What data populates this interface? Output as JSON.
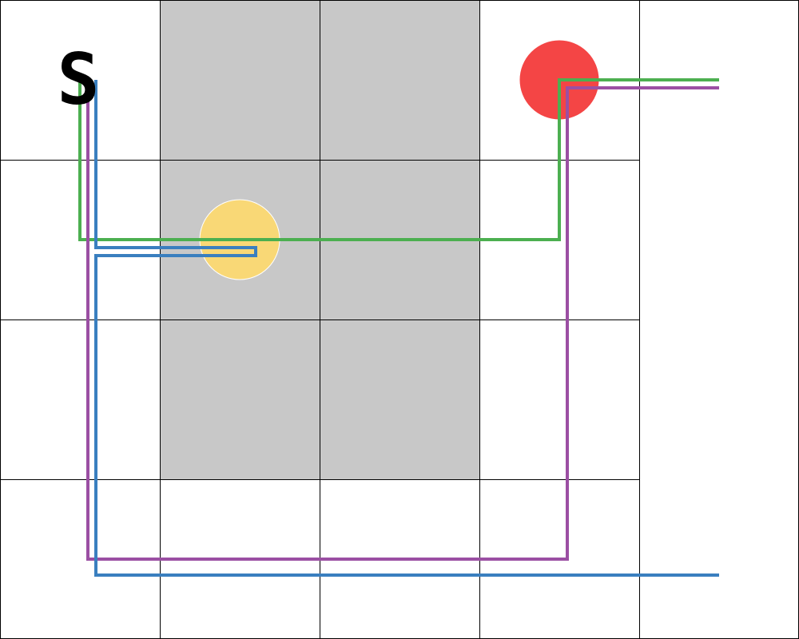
{
  "grid": {
    "cols": 5,
    "rows": 4,
    "blocked_cells": [
      [
        1,
        0
      ],
      [
        2,
        0
      ],
      [
        1,
        1
      ],
      [
        2,
        1
      ],
      [
        1,
        2
      ],
      [
        2,
        2
      ]
    ],
    "colors": {
      "background": "#ffffff",
      "blocked": "#c8c8c8",
      "line": "#000000"
    }
  },
  "start": {
    "label": "S",
    "cell": [
      0,
      0
    ]
  },
  "tokens": [
    {
      "name": "red-goal-token",
      "cell": [
        3,
        0
      ],
      "color": "#f44545"
    },
    {
      "name": "yellow-token",
      "cell": [
        1,
        1
      ],
      "color": "#f9d876"
    }
  ],
  "paths": [
    {
      "name": "green-path",
      "color": "#4caf50"
    },
    {
      "name": "purple-path",
      "color": "#9b4fa3"
    },
    {
      "name": "blue-path",
      "color": "#3a7fbf"
    }
  ]
}
